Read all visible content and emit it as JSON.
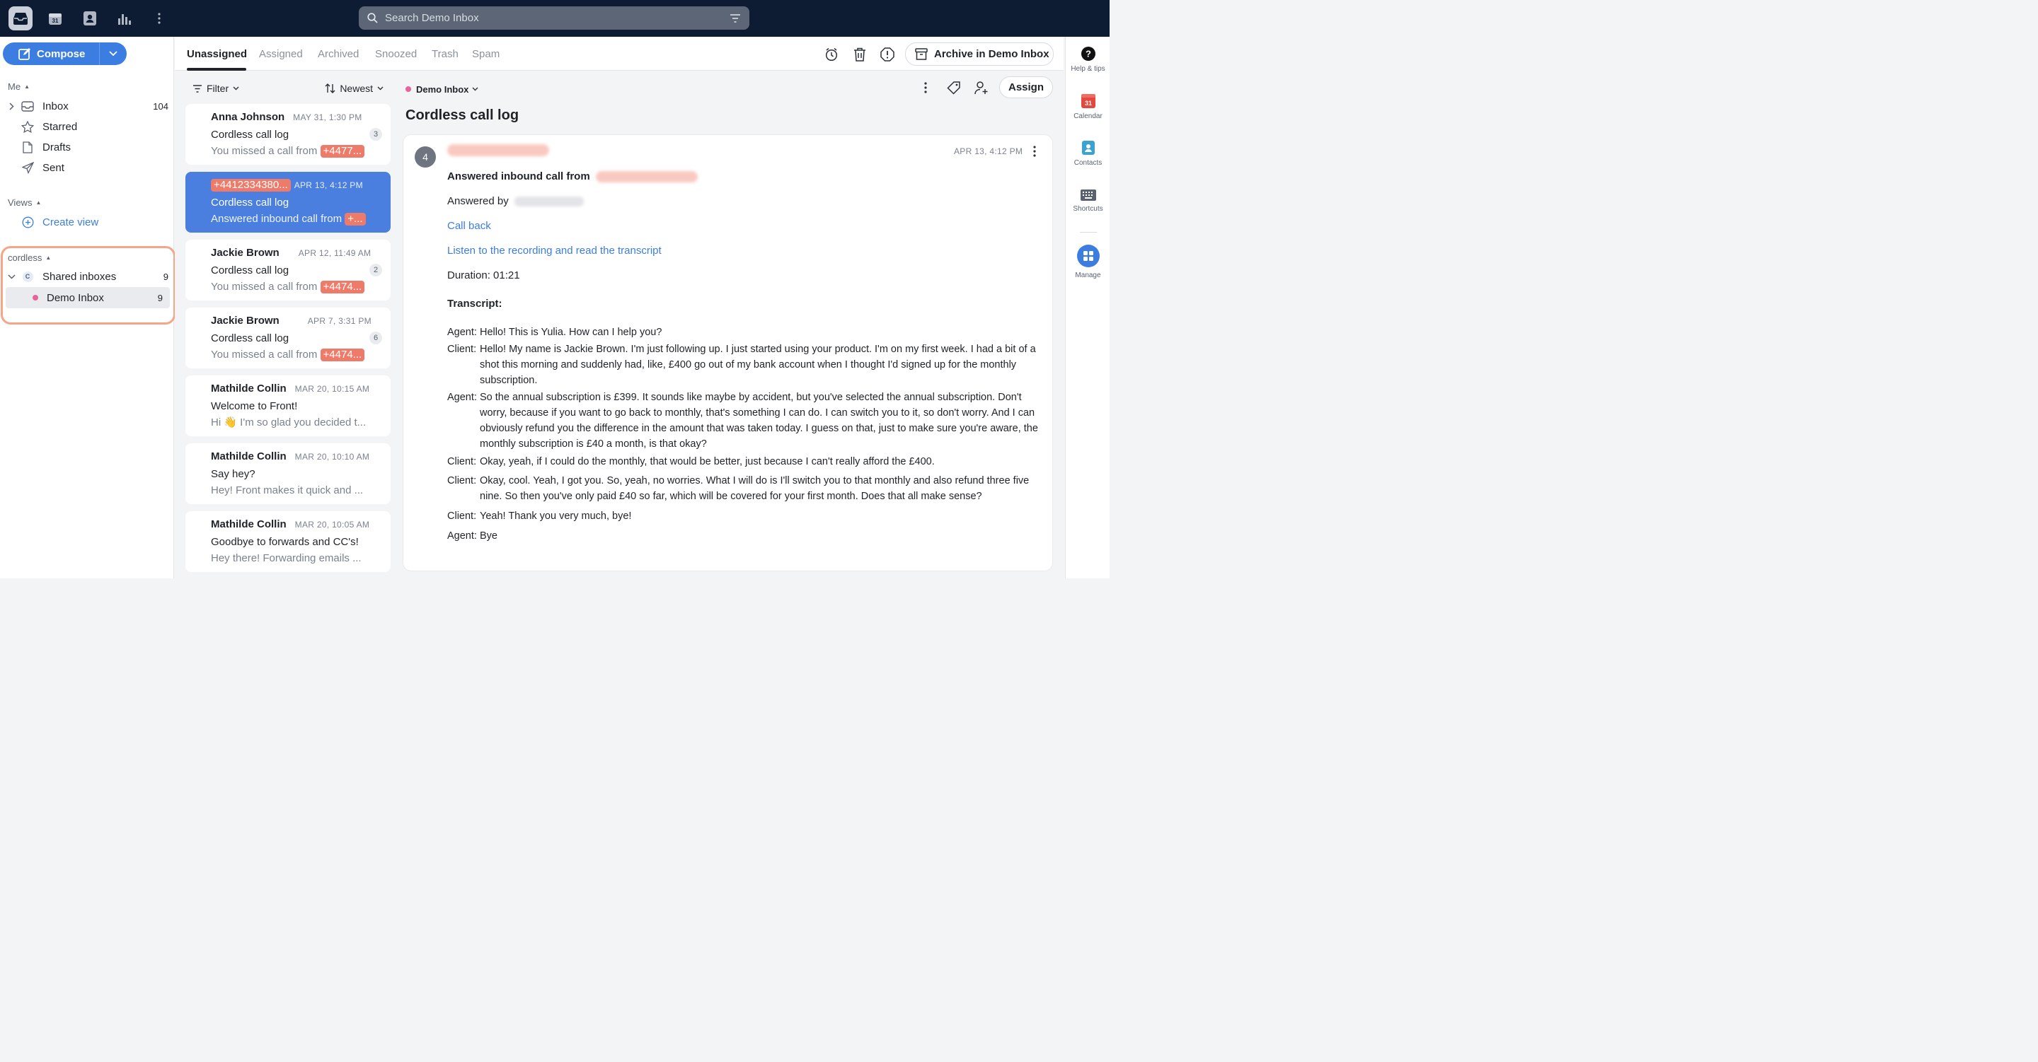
{
  "topbar": {
    "icons": [
      "inbox-icon",
      "calendar-icon",
      "contacts-icon",
      "analytics-icon",
      "more-vertical-icon"
    ],
    "search_placeholder": "Search Demo Inbox"
  },
  "compose": {
    "label": "Compose"
  },
  "sidebar": {
    "me_label": "Me",
    "items": [
      {
        "label": "Inbox",
        "count": "104",
        "icon": "inbox-icon"
      },
      {
        "label": "Starred",
        "icon": "star-icon"
      },
      {
        "label": "Drafts",
        "icon": "draft-icon"
      },
      {
        "label": "Sent",
        "icon": "send-icon"
      }
    ],
    "views_label": "Views",
    "create_view": "Create view",
    "team_label": "cordless",
    "shared_inboxes": {
      "label": "Shared inboxes",
      "count": "9",
      "badge": "C"
    },
    "demo_inbox": {
      "label": "Demo Inbox",
      "count": "9"
    }
  },
  "tabs": {
    "items": [
      "Unassigned",
      "Assigned",
      "Archived",
      "Snoozed",
      "Trash",
      "Spam"
    ],
    "active": "Unassigned",
    "archive_button": "Archive in Demo Inbox"
  },
  "list_controls": {
    "filter": "Filter",
    "sort": "Newest"
  },
  "conversations": [
    {
      "name": "Anna Johnson",
      "date": "MAY 31, 1:30 PM",
      "subject": "Cordless call log",
      "preview": "You missed a call from",
      "pill": "+4477...",
      "badge": "3"
    },
    {
      "name_pill": "+4412334380...",
      "date": "APR 13, 4:12 PM",
      "subject": "Cordless call log",
      "preview": "Answered inbound call from",
      "pill": "+...",
      "selected": true
    },
    {
      "name": "Jackie Brown",
      "date": "APR 12, 11:49 AM",
      "subject": "Cordless call log",
      "preview": "You missed a call from",
      "pill": "+4474...",
      "badge": "2"
    },
    {
      "name": "Jackie Brown",
      "date": "APR 7, 3:31 PM",
      "subject": "Cordless call log",
      "preview": "You missed a call from",
      "pill": "+4474...",
      "badge": "6"
    },
    {
      "name": "Mathilde Collin",
      "date": "MAR 20, 10:15 AM",
      "subject": "Welcome to Front!",
      "preview": "Hi 👋 I'm so glad you decided t..."
    },
    {
      "name": "Mathilde Collin",
      "date": "MAR 20, 10:10 AM",
      "subject": "Say hey?",
      "preview": "Hey! Front makes it quick and ..."
    },
    {
      "name": "Mathilde Collin",
      "date": "MAR 20, 10:05 AM",
      "subject": "Goodbye to forwards and CC's!",
      "preview": "Hey there! Forwarding emails ..."
    }
  ],
  "detail": {
    "inbox_label": "Demo Inbox",
    "title": "Cordless call log",
    "assign_button": "Assign",
    "message": {
      "avatar_count": "4",
      "date": "APR 13, 4:12 PM",
      "answered_from": "Answered inbound call from",
      "answered_by": "Answered by",
      "call_back": "Call back",
      "recording_link": "Listen to the recording and read the transcript",
      "duration": "Duration: 01:21",
      "transcript_label": "Transcript:",
      "transcript": [
        {
          "speaker": "Agent:",
          "text": "Hello! This is Yulia. How can I help you?"
        },
        {
          "speaker": "Client:",
          "text": "Hello! My name is Jackie Brown. I'm just following up. I just started using your product. I'm on my first week. I had a bit of a shot this morning and suddenly had, like, £400 go out of my bank account when I thought I'd signed up for the monthly subscription."
        },
        {
          "speaker": "Agent:",
          "text": "So the annual subscription is £399. It sounds like maybe by accident, but you've selected the annual subscription. Don't worry, because if you want to go back to monthly, that's something I can do. I can switch you to it, so don't worry. And I can obviously refund you the difference in the amount that was taken today. I guess on that, just to make sure you're aware, the monthly subscription is £40 a month, is that okay?"
        },
        {
          "speaker": "Client:",
          "text": "Okay, yeah, if I could do the monthly, that would be better, just because I can't really afford the £400."
        },
        {
          "speaker": "Client:",
          "text": "Okay, cool. Yeah, I got you. So, yeah, no worries. What I will do is I'll switch you to that monthly and also refund three five nine. So then you've only paid £40 so far, which will be covered for your first month. Does that all make sense?"
        },
        {
          "speaker": "Client:",
          "text": "Yeah! Thank you very much, bye!"
        },
        {
          "speaker": "Agent:",
          "text": "Bye"
        }
      ]
    }
  },
  "rightbar": {
    "items": [
      {
        "label": "Help & tips",
        "icon": "help-icon"
      },
      {
        "label": "Calendar",
        "icon": "calendar-icon",
        "day": "31"
      },
      {
        "label": "Contacts",
        "icon": "contacts-icon"
      },
      {
        "label": "Shortcuts",
        "icon": "keyboard-icon"
      },
      {
        "label": "Manage",
        "icon": "manage-grid-icon"
      }
    ]
  },
  "colors": {
    "accent": "#3b7de0",
    "topbar": "#0d1b33",
    "pill": "#ee7b6a",
    "highlight": "#f4a58a",
    "inbox_dot": "#e8629b"
  }
}
